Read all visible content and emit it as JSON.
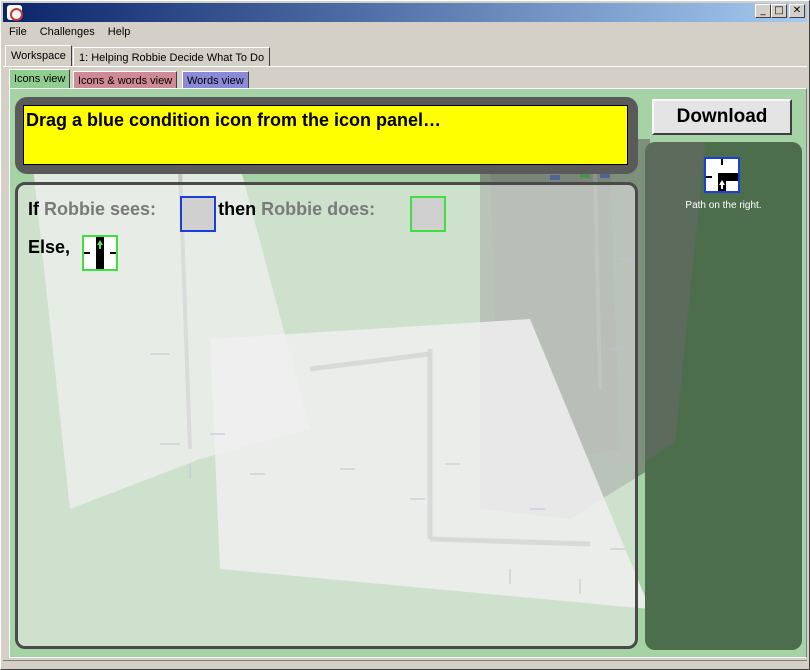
{
  "window": {
    "title": "",
    "controls": {
      "minimize": "_",
      "maximize": "□",
      "close": "✕"
    }
  },
  "menubar": {
    "items": [
      {
        "label": "File"
      },
      {
        "label": "Challenges"
      },
      {
        "label": "Help"
      }
    ]
  },
  "tabs": {
    "outer": [
      {
        "label": "Workspace",
        "selected": true
      },
      {
        "label": "1: Helping Robbie Decide What To Do",
        "selected": false
      }
    ],
    "inner": [
      {
        "label": "Icons view",
        "selected": true,
        "color": "#8fce8f"
      },
      {
        "label": "Icons & words view",
        "selected": false,
        "color": "#d08a96"
      },
      {
        "label": "Words view",
        "selected": false,
        "color": "#8a8ad8"
      }
    ]
  },
  "instruction": {
    "text": "Drag a blue condition icon from the icon panel…",
    "background": "#ffff00"
  },
  "rule": {
    "if_label": "If",
    "robbie_sees": "Robbie sees:",
    "then_label": ", then",
    "robbie_does": "Robbie does:",
    "else_label": "Else,",
    "condition_slot_color": "#1a3fd8",
    "action_slot_color": "#3ee03e",
    "else_icon": "path-straight-up-icon"
  },
  "right_panel": {
    "download_label": "Download",
    "icons": [
      {
        "caption": "Path on the right.",
        "icon": "path-on-right-icon",
        "border": "#1a3fd8"
      }
    ]
  },
  "colors": {
    "workspace_green": "#a6d3a6",
    "icon_panel_green": "#4d6e4d"
  }
}
